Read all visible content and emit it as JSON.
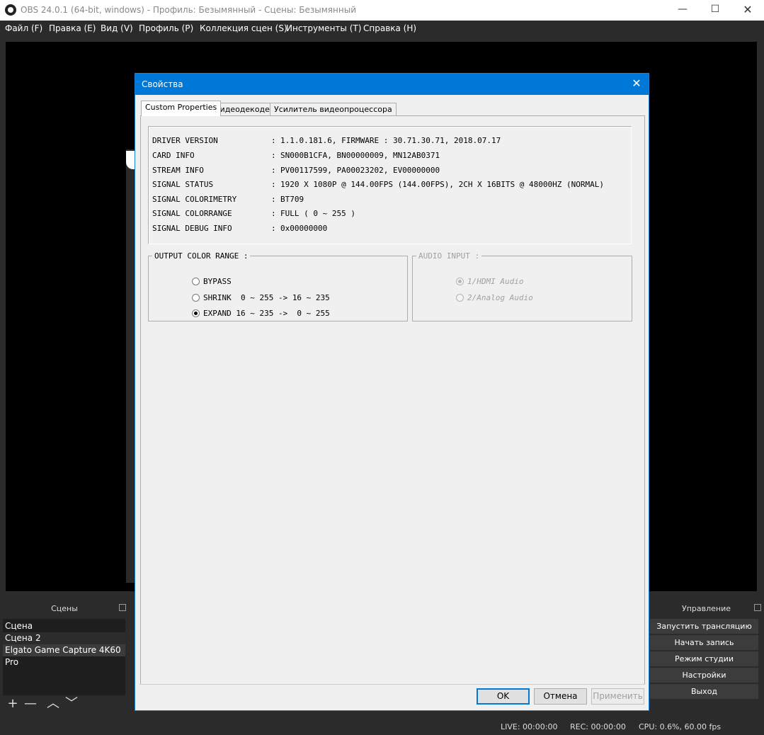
{
  "app": {
    "title": "OBS 24.0.1 (64-bit, windows) - Профиль: Безымянный - Сцены: Безымянный",
    "minimize": "—",
    "maximize": "☐",
    "close": "✕"
  },
  "menu": [
    "Файл (F)",
    "Правка (E)",
    "Вид (V)",
    "Профиль (P)",
    "Коллекция сцен (S)",
    "Инструменты (T)",
    "Справка (H)"
  ],
  "scenes": {
    "title": "Сцены",
    "items": [
      "Сцена",
      "Сцена 2",
      "Elgato Game Capture 4K60 Pro"
    ],
    "toolbar": {
      "add": "+",
      "remove": "—",
      "up": "︿",
      "down": "﹀"
    }
  },
  "controls": {
    "title": "Управление",
    "buttons": [
      "Запустить трансляцию",
      "Начать запись",
      "Режим студии",
      "Настройки",
      "Выход"
    ]
  },
  "status": {
    "live": "LIVE: 00:00:00",
    "rec": "REC: 00:00:00",
    "cpu": "CPU: 0.6%, 60.00 fps"
  },
  "dialog": {
    "title": "Свойства",
    "close": "✕",
    "tabs": [
      "Custom Properties",
      "Видеодекодер",
      "Усилитель видеопроцессора"
    ],
    "info": [
      {
        "label": "DRIVER VERSION",
        "value": "1.1.0.181.6, FIRMWARE : 30.71.30.71, 2018.07.17"
      },
      {
        "label": "CARD INFO",
        "value": "SN000B1CFA, BN00000009, MN12AB0371"
      },
      {
        "label": "STREAM INFO",
        "value": "PV00117599, PA00023202, EV00000000"
      },
      {
        "label": "SIGNAL STATUS",
        "value": "1920 X 1080P @ 144.00FPS (144.00FPS), 2CH X 16BITS @ 48000HZ (NORMAL)"
      },
      {
        "label": "SIGNAL COLORIMETRY",
        "value": "BT709"
      },
      {
        "label": "SIGNAL COLORRANGE",
        "value": "FULL ( 0 ~ 255 )"
      },
      {
        "label": "SIGNAL DEBUG INFO",
        "value": "0x00000000"
      }
    ],
    "output_color_range": {
      "title": "OUTPUT COLOR RANGE :",
      "options": [
        "BYPASS",
        "SHRINK  0 ~ 255 -> 16 ~ 235",
        "EXPAND 16 ~ 235 ->  0 ~ 255"
      ],
      "selected": 2
    },
    "audio_input": {
      "title": "AUDIO INPUT :",
      "options": [
        "1/HDMI Audio",
        "2/Analog Audio"
      ],
      "selected": 0,
      "enabled": false
    },
    "buttons": {
      "ok": "OK",
      "cancel": "Отмена",
      "apply": "Применить"
    }
  }
}
